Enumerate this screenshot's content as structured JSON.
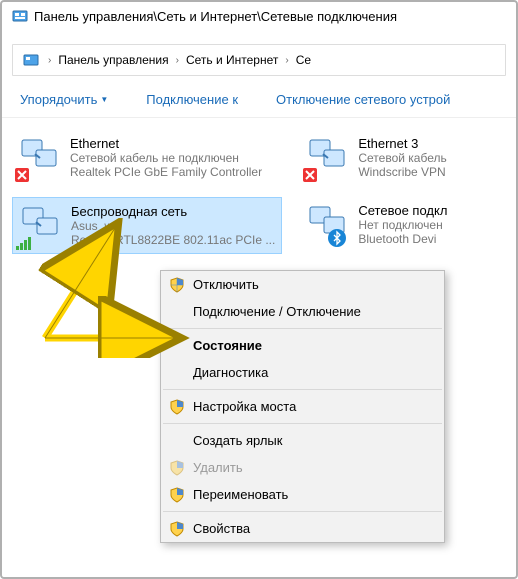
{
  "title": "Панель управления\\Сеть и Интернет\\Сетевые подключения",
  "breadcrumb": {
    "b1": "Панель управления",
    "b2": "Сеть и Интернет",
    "b3": "Се"
  },
  "toolbar": {
    "organize": "Упорядочить",
    "connect": "Подключение к",
    "disable": "Отключение сетевого устрой"
  },
  "connections": {
    "c1": {
      "title": "Ethernet",
      "sub": "Сетевой кабель не подключен",
      "dev": "Realtek PCIe GbE Family Controller"
    },
    "c2": {
      "title": "Беспроводная сеть",
      "sub": "Asus_wifi",
      "dev": "Realtek RTL8822BE 802.11ac PCIe ..."
    },
    "c3": {
      "title": "Ethernet 3",
      "sub": "Сетевой кабель",
      "dev": "Windscribe VPN"
    },
    "c4": {
      "title": "Сетевое подкл",
      "sub": "Нет подключен",
      "dev": "Bluetooth Devi"
    }
  },
  "menu": {
    "m1": "Отключить",
    "m2": "Подключение / Отключение",
    "m3": "Состояние",
    "m4": "Диагностика",
    "m5": "Настройка моста",
    "m6": "Создать ярлык",
    "m7": "Удалить",
    "m8": "Переименовать",
    "m9": "Свойства"
  }
}
